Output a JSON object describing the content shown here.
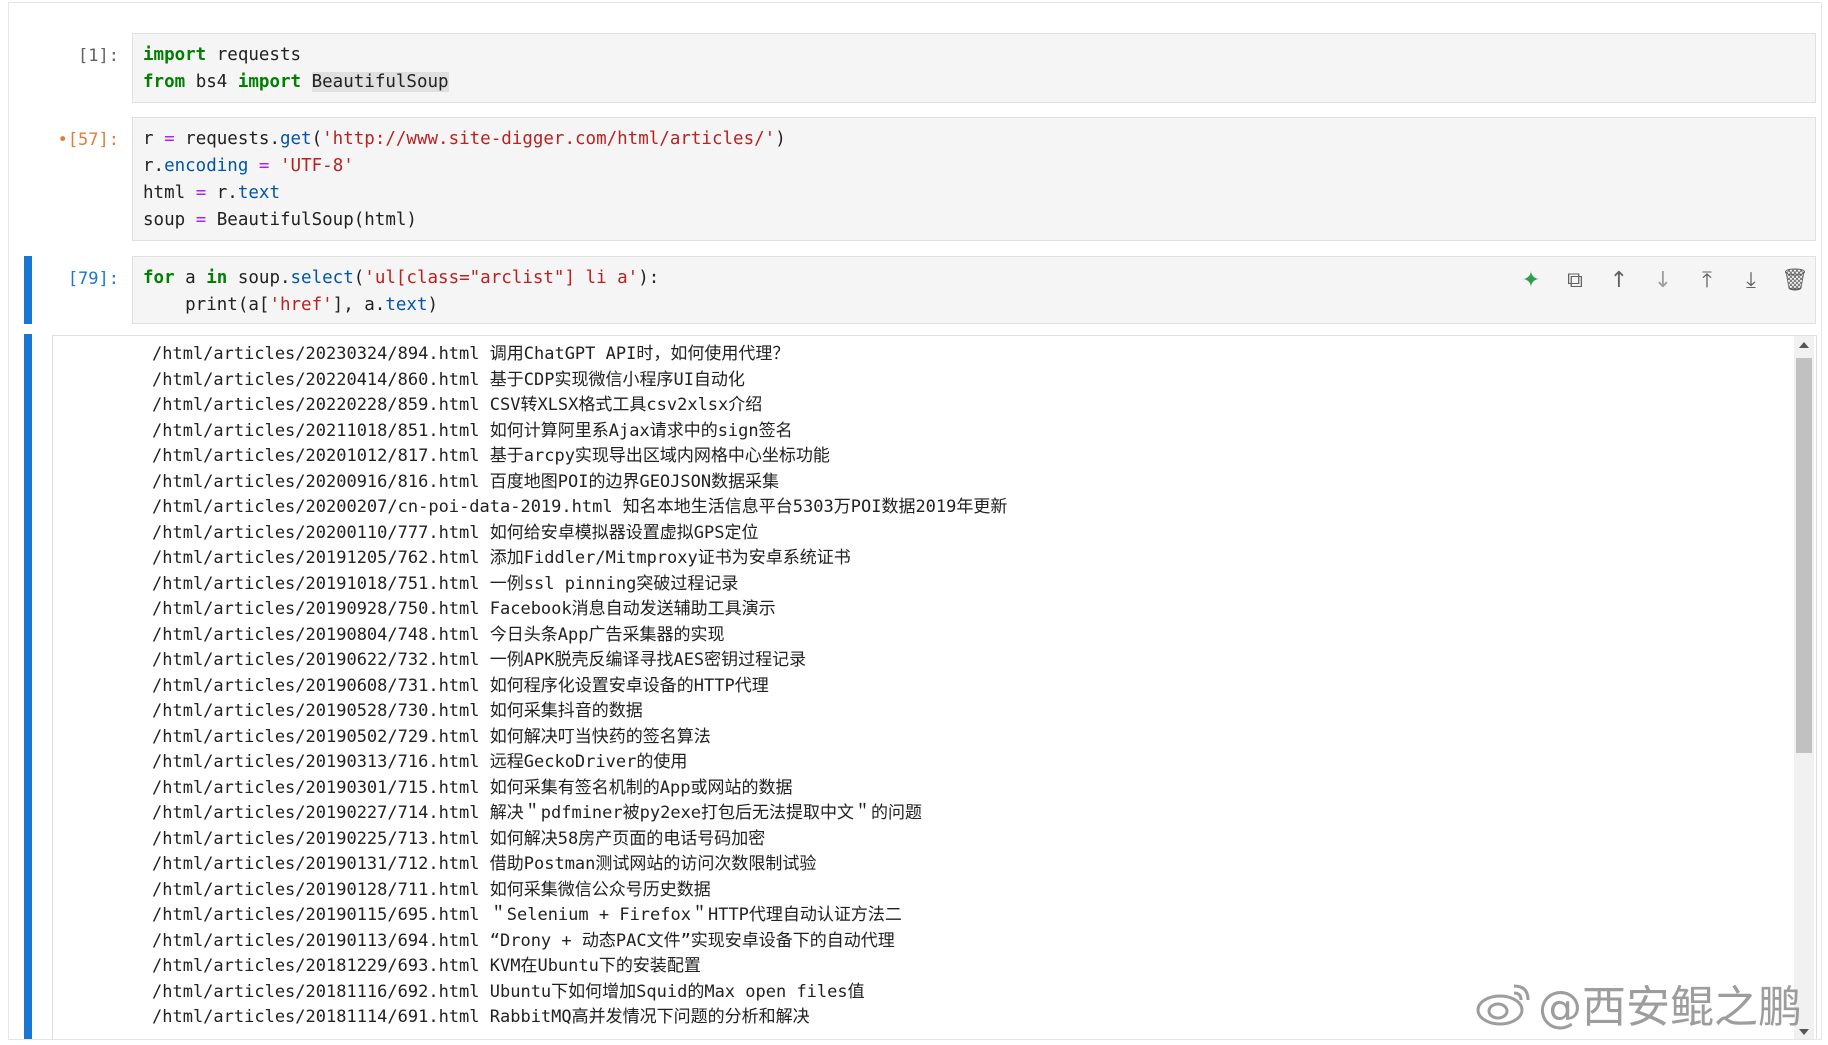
{
  "cells": [
    {
      "prompt": "[1]:",
      "lines": [
        [
          {
            "t": "import",
            "c": "kw"
          },
          {
            "t": " requests",
            "c": ""
          }
        ],
        [
          {
            "t": "from",
            "c": "kw"
          },
          {
            "t": " bs4 ",
            "c": ""
          },
          {
            "t": "import",
            "c": "kw"
          },
          {
            "t": " ",
            "c": ""
          },
          {
            "t": "BeautifulSoup",
            "c": "hl"
          }
        ]
      ]
    },
    {
      "prompt": "•[57]:",
      "lines": [
        [
          {
            "t": "r ",
            "c": ""
          },
          {
            "t": "=",
            "c": "op"
          },
          {
            "t": " requests.",
            "c": ""
          },
          {
            "t": "get",
            "c": "attr"
          },
          {
            "t": "(",
            "c": ""
          },
          {
            "t": "'http://www.site-digger.com/html/articles/'",
            "c": "str"
          },
          {
            "t": ")",
            "c": ""
          }
        ],
        [
          {
            "t": "r.",
            "c": ""
          },
          {
            "t": "encoding",
            "c": "attr"
          },
          {
            "t": " ",
            "c": ""
          },
          {
            "t": "=",
            "c": "op"
          },
          {
            "t": " ",
            "c": ""
          },
          {
            "t": "'UTF-8'",
            "c": "str"
          }
        ],
        [
          {
            "t": "html ",
            "c": ""
          },
          {
            "t": "=",
            "c": "op"
          },
          {
            "t": " r.",
            "c": ""
          },
          {
            "t": "text",
            "c": "attr"
          }
        ],
        [
          {
            "t": "soup ",
            "c": ""
          },
          {
            "t": "=",
            "c": "op"
          },
          {
            "t": " BeautifulSoup(html)",
            "c": ""
          }
        ]
      ]
    },
    {
      "prompt": "[79]:",
      "lines": [
        [
          {
            "t": "for",
            "c": "kw"
          },
          {
            "t": " a ",
            "c": ""
          },
          {
            "t": "in",
            "c": "kw"
          },
          {
            "t": " soup.",
            "c": ""
          },
          {
            "t": "select",
            "c": "attr"
          },
          {
            "t": "(",
            "c": ""
          },
          {
            "t": "'ul[class=\"arclist\"] li a'",
            "c": "str"
          },
          {
            "t": "):",
            "c": ""
          }
        ],
        [
          {
            "t": "    print(a[",
            "c": ""
          },
          {
            "t": "'href'",
            "c": "str"
          },
          {
            "t": "], a.",
            "c": ""
          },
          {
            "t": "text",
            "c": "attr"
          },
          {
            "t": ")",
            "c": ""
          }
        ]
      ]
    }
  ],
  "toolbar": [
    {
      "name": "ai-assist-icon",
      "glyph": "✦",
      "color": "#2e9e4f"
    },
    {
      "name": "duplicate-icon",
      "glyph": "⧉",
      "color": "#616161"
    },
    {
      "name": "move-up-icon",
      "glyph": "↑",
      "color": "#616161"
    },
    {
      "name": "move-down-icon",
      "glyph": "↓",
      "color": "#9e9e9e"
    },
    {
      "name": "insert-above-icon",
      "glyph": "⤒",
      "color": "#616161"
    },
    {
      "name": "insert-below-icon",
      "glyph": "⤓",
      "color": "#616161"
    },
    {
      "name": "delete-icon",
      "glyph": "🗑",
      "color": "#616161"
    }
  ],
  "output_lines": [
    "/html/articles/20230324/894.html 调用ChatGPT API时，如何使用代理？",
    "/html/articles/20220414/860.html 基于CDP实现微信小程序UI自动化",
    "/html/articles/20220228/859.html CSV转XLSX格式工具csv2xlsx介绍",
    "/html/articles/20211018/851.html 如何计算阿里系Ajax请求中的sign签名",
    "/html/articles/20201012/817.html 基于arcpy实现导出区域内网格中心坐标功能",
    "/html/articles/20200916/816.html 百度地图POI的边界GEOJSON数据采集",
    "/html/articles/20200207/cn-poi-data-2019.html 知名本地生活信息平台5303万POI数据2019年更新",
    "/html/articles/20200110/777.html 如何给安卓模拟器设置虚拟GPS定位",
    "/html/articles/20191205/762.html 添加Fiddler/Mitmproxy证书为安卓系统证书",
    "/html/articles/20191018/751.html 一例ssl pinning突破过程记录",
    "/html/articles/20190928/750.html Facebook消息自动发送辅助工具演示",
    "/html/articles/20190804/748.html 今日头条App广告采集器的实现",
    "/html/articles/20190622/732.html 一例APK脱壳反编译寻找AES密钥过程记录",
    "/html/articles/20190608/731.html 如何程序化设置安卓设备的HTTP代理",
    "/html/articles/20190528/730.html 如何采集抖音的数据",
    "/html/articles/20190502/729.html 如何解决叮当快药的签名算法",
    "/html/articles/20190313/716.html 远程GeckoDriver的使用",
    "/html/articles/20190301/715.html 如何采集有签名机制的App或网站的数据",
    "/html/articles/20190227/714.html 解决＂pdfminer被py2exe打包后无法提取中文＂的问题",
    "/html/articles/20190225/713.html 如何解决58房产页面的电话号码加密",
    "/html/articles/20190131/712.html 借助Postman测试网站的访问次数限制试验",
    "/html/articles/20190128/711.html 如何采集微信公众号历史数据",
    "/html/articles/20190115/695.html ＂Selenium + Firefox＂HTTP代理自动认证方法二",
    "/html/articles/20190113/694.html “Drony + 动态PAC文件”实现安卓设备下的自动代理",
    "/html/articles/20181229/693.html KVM在Ubuntu下的安装配置",
    "/html/articles/20181116/692.html Ubuntu下如何增加Squid的Max open files值",
    "/html/articles/20181114/691.html RabbitMQ高并发情况下问题的分析和解决"
  ],
  "watermark": "@西安鲲之鹏"
}
